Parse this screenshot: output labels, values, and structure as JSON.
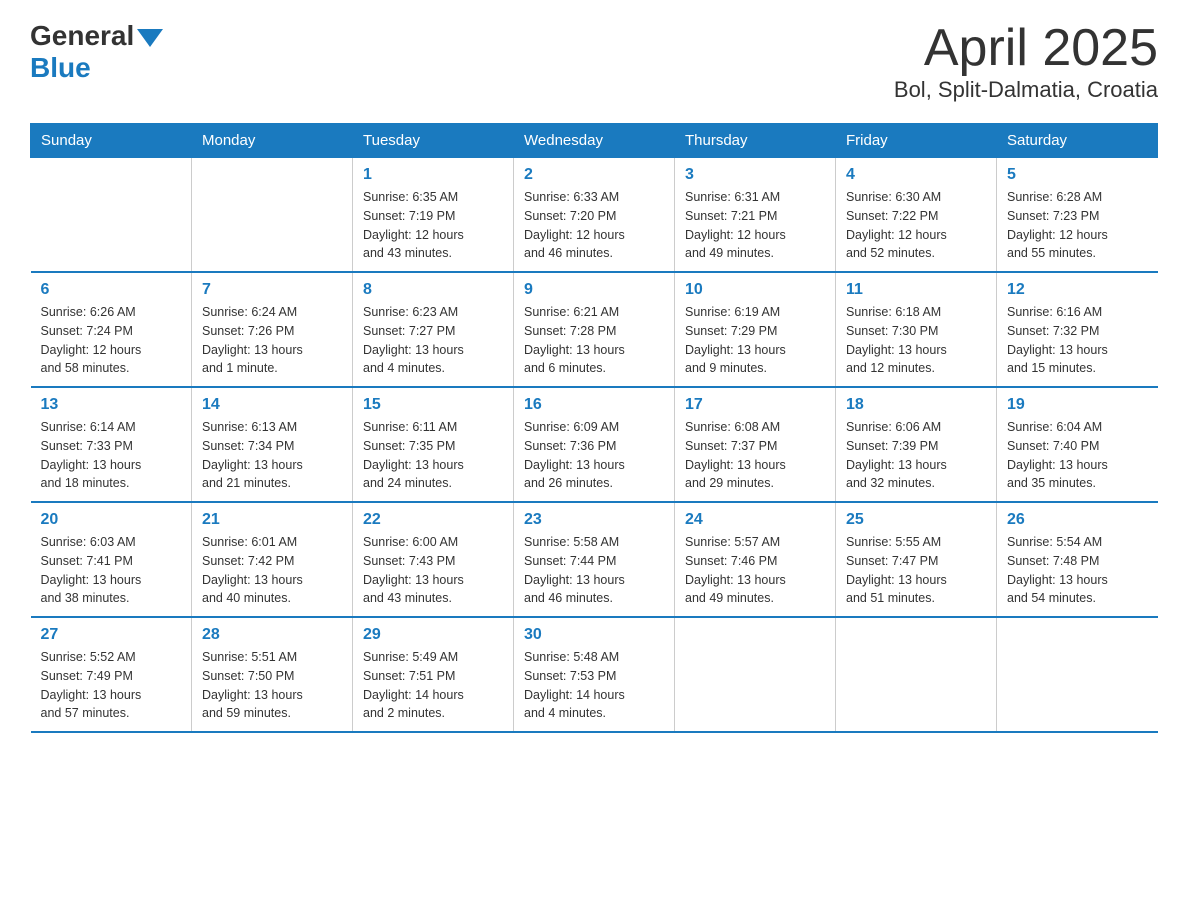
{
  "header": {
    "logo_general": "General",
    "logo_blue": "Blue",
    "title": "April 2025",
    "subtitle": "Bol, Split-Dalmatia, Croatia"
  },
  "days_of_week": [
    "Sunday",
    "Monday",
    "Tuesday",
    "Wednesday",
    "Thursday",
    "Friday",
    "Saturday"
  ],
  "weeks": [
    [
      {
        "num": "",
        "info": ""
      },
      {
        "num": "",
        "info": ""
      },
      {
        "num": "1",
        "info": "Sunrise: 6:35 AM\nSunset: 7:19 PM\nDaylight: 12 hours\nand 43 minutes."
      },
      {
        "num": "2",
        "info": "Sunrise: 6:33 AM\nSunset: 7:20 PM\nDaylight: 12 hours\nand 46 minutes."
      },
      {
        "num": "3",
        "info": "Sunrise: 6:31 AM\nSunset: 7:21 PM\nDaylight: 12 hours\nand 49 minutes."
      },
      {
        "num": "4",
        "info": "Sunrise: 6:30 AM\nSunset: 7:22 PM\nDaylight: 12 hours\nand 52 minutes."
      },
      {
        "num": "5",
        "info": "Sunrise: 6:28 AM\nSunset: 7:23 PM\nDaylight: 12 hours\nand 55 minutes."
      }
    ],
    [
      {
        "num": "6",
        "info": "Sunrise: 6:26 AM\nSunset: 7:24 PM\nDaylight: 12 hours\nand 58 minutes."
      },
      {
        "num": "7",
        "info": "Sunrise: 6:24 AM\nSunset: 7:26 PM\nDaylight: 13 hours\nand 1 minute."
      },
      {
        "num": "8",
        "info": "Sunrise: 6:23 AM\nSunset: 7:27 PM\nDaylight: 13 hours\nand 4 minutes."
      },
      {
        "num": "9",
        "info": "Sunrise: 6:21 AM\nSunset: 7:28 PM\nDaylight: 13 hours\nand 6 minutes."
      },
      {
        "num": "10",
        "info": "Sunrise: 6:19 AM\nSunset: 7:29 PM\nDaylight: 13 hours\nand 9 minutes."
      },
      {
        "num": "11",
        "info": "Sunrise: 6:18 AM\nSunset: 7:30 PM\nDaylight: 13 hours\nand 12 minutes."
      },
      {
        "num": "12",
        "info": "Sunrise: 6:16 AM\nSunset: 7:32 PM\nDaylight: 13 hours\nand 15 minutes."
      }
    ],
    [
      {
        "num": "13",
        "info": "Sunrise: 6:14 AM\nSunset: 7:33 PM\nDaylight: 13 hours\nand 18 minutes."
      },
      {
        "num": "14",
        "info": "Sunrise: 6:13 AM\nSunset: 7:34 PM\nDaylight: 13 hours\nand 21 minutes."
      },
      {
        "num": "15",
        "info": "Sunrise: 6:11 AM\nSunset: 7:35 PM\nDaylight: 13 hours\nand 24 minutes."
      },
      {
        "num": "16",
        "info": "Sunrise: 6:09 AM\nSunset: 7:36 PM\nDaylight: 13 hours\nand 26 minutes."
      },
      {
        "num": "17",
        "info": "Sunrise: 6:08 AM\nSunset: 7:37 PM\nDaylight: 13 hours\nand 29 minutes."
      },
      {
        "num": "18",
        "info": "Sunrise: 6:06 AM\nSunset: 7:39 PM\nDaylight: 13 hours\nand 32 minutes."
      },
      {
        "num": "19",
        "info": "Sunrise: 6:04 AM\nSunset: 7:40 PM\nDaylight: 13 hours\nand 35 minutes."
      }
    ],
    [
      {
        "num": "20",
        "info": "Sunrise: 6:03 AM\nSunset: 7:41 PM\nDaylight: 13 hours\nand 38 minutes."
      },
      {
        "num": "21",
        "info": "Sunrise: 6:01 AM\nSunset: 7:42 PM\nDaylight: 13 hours\nand 40 minutes."
      },
      {
        "num": "22",
        "info": "Sunrise: 6:00 AM\nSunset: 7:43 PM\nDaylight: 13 hours\nand 43 minutes."
      },
      {
        "num": "23",
        "info": "Sunrise: 5:58 AM\nSunset: 7:44 PM\nDaylight: 13 hours\nand 46 minutes."
      },
      {
        "num": "24",
        "info": "Sunrise: 5:57 AM\nSunset: 7:46 PM\nDaylight: 13 hours\nand 49 minutes."
      },
      {
        "num": "25",
        "info": "Sunrise: 5:55 AM\nSunset: 7:47 PM\nDaylight: 13 hours\nand 51 minutes."
      },
      {
        "num": "26",
        "info": "Sunrise: 5:54 AM\nSunset: 7:48 PM\nDaylight: 13 hours\nand 54 minutes."
      }
    ],
    [
      {
        "num": "27",
        "info": "Sunrise: 5:52 AM\nSunset: 7:49 PM\nDaylight: 13 hours\nand 57 minutes."
      },
      {
        "num": "28",
        "info": "Sunrise: 5:51 AM\nSunset: 7:50 PM\nDaylight: 13 hours\nand 59 minutes."
      },
      {
        "num": "29",
        "info": "Sunrise: 5:49 AM\nSunset: 7:51 PM\nDaylight: 14 hours\nand 2 minutes."
      },
      {
        "num": "30",
        "info": "Sunrise: 5:48 AM\nSunset: 7:53 PM\nDaylight: 14 hours\nand 4 minutes."
      },
      {
        "num": "",
        "info": ""
      },
      {
        "num": "",
        "info": ""
      },
      {
        "num": "",
        "info": ""
      }
    ]
  ]
}
